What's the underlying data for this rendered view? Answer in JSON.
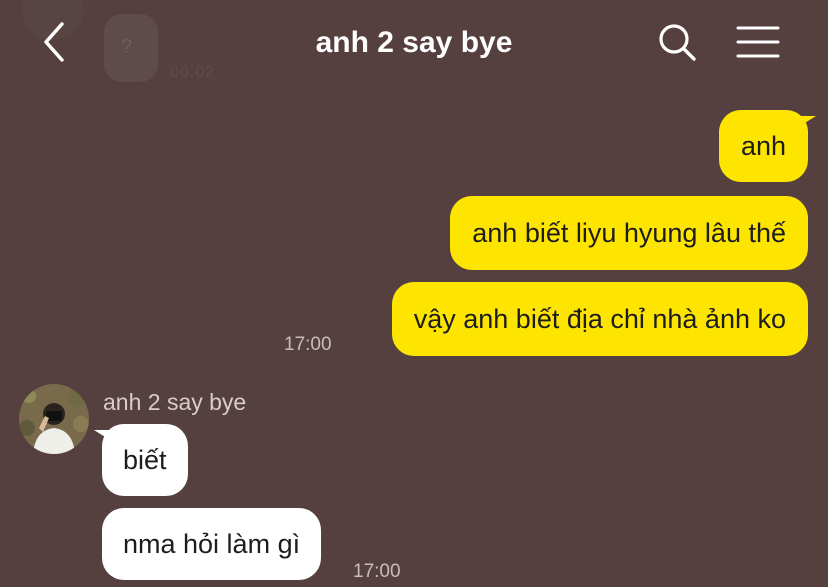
{
  "header": {
    "title": "anh 2 say bye",
    "back_icon": "chevron-left-icon",
    "search_icon": "search-icon",
    "menu_icon": "hamburger-menu-icon"
  },
  "ghost": {
    "bubble_text": "?",
    "time": "00:02"
  },
  "messages": {
    "outgoing": [
      {
        "text": "anh"
      },
      {
        "text": "anh biết liyu hyung lâu thế"
      },
      {
        "text": "vậy anh biết địa chỉ nhà ảnh ko"
      }
    ],
    "outgoing_time": "17:00",
    "sender_name": "anh 2 say bye",
    "incoming": [
      {
        "text": "biết"
      },
      {
        "text": "nma hỏi làm gì"
      }
    ],
    "incoming_time": "17:00"
  },
  "colors": {
    "background": "#563f3f",
    "outgoing_bubble": "#fee500",
    "incoming_bubble": "#ffffff"
  }
}
